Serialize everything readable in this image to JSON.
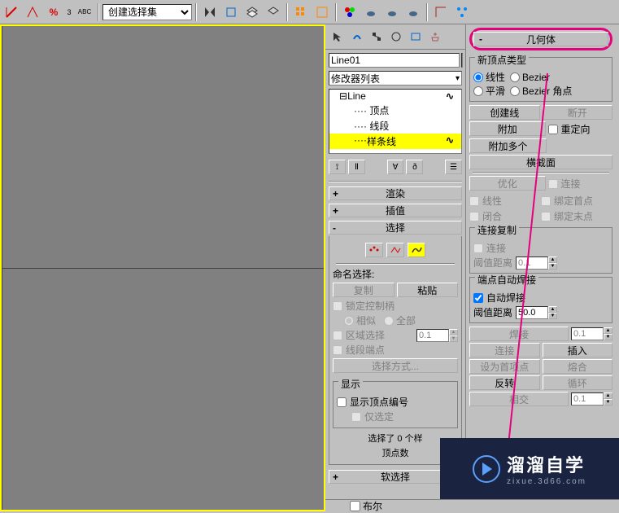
{
  "top_toolbar": {
    "selection_set_placeholder": "创建选择集"
  },
  "modifier_panel": {
    "object_name": "Line01",
    "modifier_list_label": "修改器列表",
    "stack": {
      "root": "Line",
      "sub1": "顶点",
      "sub2": "线段",
      "sub3": "样条线"
    },
    "rollouts": {
      "rendering": "渲染",
      "interpolation": "插值",
      "selection": "选择"
    },
    "named_sel": {
      "title": "命名选择:",
      "copy": "复制",
      "paste": "粘贴"
    },
    "lock_handles": "锁定控制柄",
    "handle_mode": {
      "relative": "相似",
      "all": "全部"
    },
    "area_selection": "区域选择",
    "area_value": "0.1",
    "segment_end": "线段端点",
    "select_by_btn": "选择方式...",
    "display_group": "显示",
    "show_vert_num": "显示顶点编号",
    "selected_only": "仅选定",
    "status1": "选择了 0 个样",
    "status2": "顶点数",
    "soft_sel": "软选择"
  },
  "geometry_panel": {
    "header": "几何体",
    "new_vert_type": {
      "title": "新顶点类型",
      "linear": "线性",
      "bezier": "Bezier",
      "smooth": "平滑",
      "bezier_corner": "Bezier 角点"
    },
    "create_line": "创建线",
    "break": "断开",
    "attach": "附加",
    "reorient": "重定向",
    "attach_mult": "附加多个",
    "cross_section": "横截面",
    "refine": "优化",
    "connect_chk": "连接",
    "linear_chk": "线性",
    "bind_first": "绑定首点",
    "closed": "闭合",
    "bind_last": "绑定末点",
    "connect_copy": {
      "title": "连接复制",
      "connect": "连接",
      "threshold": "阈值距离",
      "val": "0.1"
    },
    "end_auto_weld": {
      "title": "端点自动焊接",
      "auto_weld": "自动焊接",
      "threshold": "阈值距离",
      "val": "50.0"
    },
    "weld": "焊接",
    "weld_val": "0.1",
    "connect_btn": "连接",
    "insert": "插入",
    "make_first": "设为首项点",
    "fuse": "熔合",
    "reverse": "反转",
    "cycle": "循环",
    "cross_insert": "相交",
    "cross_val": "0.1",
    "fillet_label": "布尔"
  }
}
